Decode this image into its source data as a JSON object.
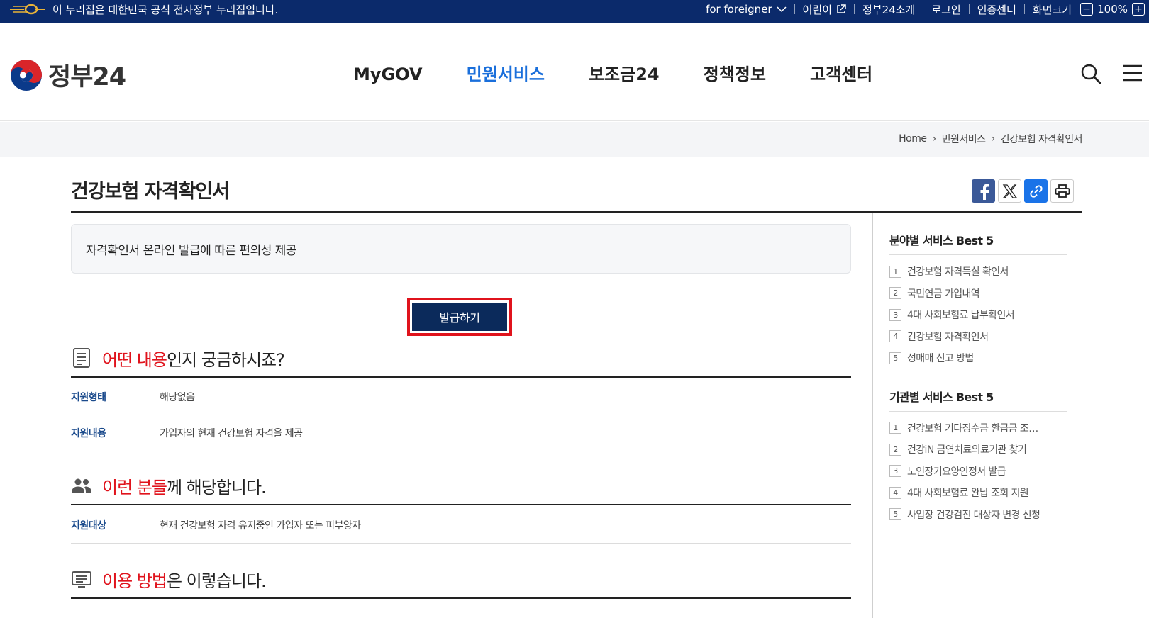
{
  "topbar": {
    "notice": "이 누리집은 대한민국 공식 전자정부 누리집입니다.",
    "foreigner": "for foreigner",
    "kids": "어린이",
    "about": "정부24소개",
    "login": "로그인",
    "cert": "인증센터",
    "screen_size": "화면크기",
    "zoom_minus": "−",
    "zoom_level": "100%",
    "zoom_plus": "+"
  },
  "header": {
    "logo_text": "정부24",
    "nav": [
      "MyGOV",
      "민원서비스",
      "보조금24",
      "정책정보",
      "고객센터"
    ],
    "active_nav": "민원서비스"
  },
  "breadcrumb": [
    "Home",
    "민원서비스",
    "건강보험 자격확인서"
  ],
  "page": {
    "title": "건강보험 자격확인서",
    "summary": "자격확인서 온라인 발급에 따른 편의성 제공",
    "issue_button": "발급하기"
  },
  "sections": [
    {
      "title_hl": "어떤 내용",
      "title_rest": "인지 궁금하시죠?",
      "rows": [
        {
          "label": "지원형태",
          "value": "해당없음"
        },
        {
          "label": "지원내용",
          "value": "가입자의 현재 건강보험 자격을 제공"
        }
      ]
    },
    {
      "title_hl": "이런 분들",
      "title_rest": "께 해당합니다.",
      "rows": [
        {
          "label": "지원대상",
          "value": "현재 건강보험 자격 유지중인 가입자 또는 피부양자"
        }
      ]
    },
    {
      "title_hl": "이용 방법",
      "title_rest": "은 이렇습니다.",
      "rows": []
    }
  ],
  "side": {
    "field_title": "분야별 서비스 Best 5",
    "field_items": [
      "건강보험 자격득실 확인서",
      "국민연금 가입내역",
      "4대 사회보험료 납부확인서",
      "건강보험 자격확인서",
      "성매매 신고 방법"
    ],
    "org_title": "기관별 서비스 Best 5",
    "org_items": [
      "건강보험 기타징수금 환급금 조…",
      "건강iN 금연치료의료기관 찾기",
      "노인장기요양인정서 발급",
      "4대 사회보험료 완납 조회 지원",
      "사업장 건강검진 대상자 변경 신청"
    ]
  },
  "colors": {
    "topbar_bg": "#0b2a6b",
    "nav_active": "#1a6fdb",
    "highlight_red": "#e0131c",
    "button_navy": "#0b2a5b",
    "label_blue": "#1a4a8c"
  }
}
